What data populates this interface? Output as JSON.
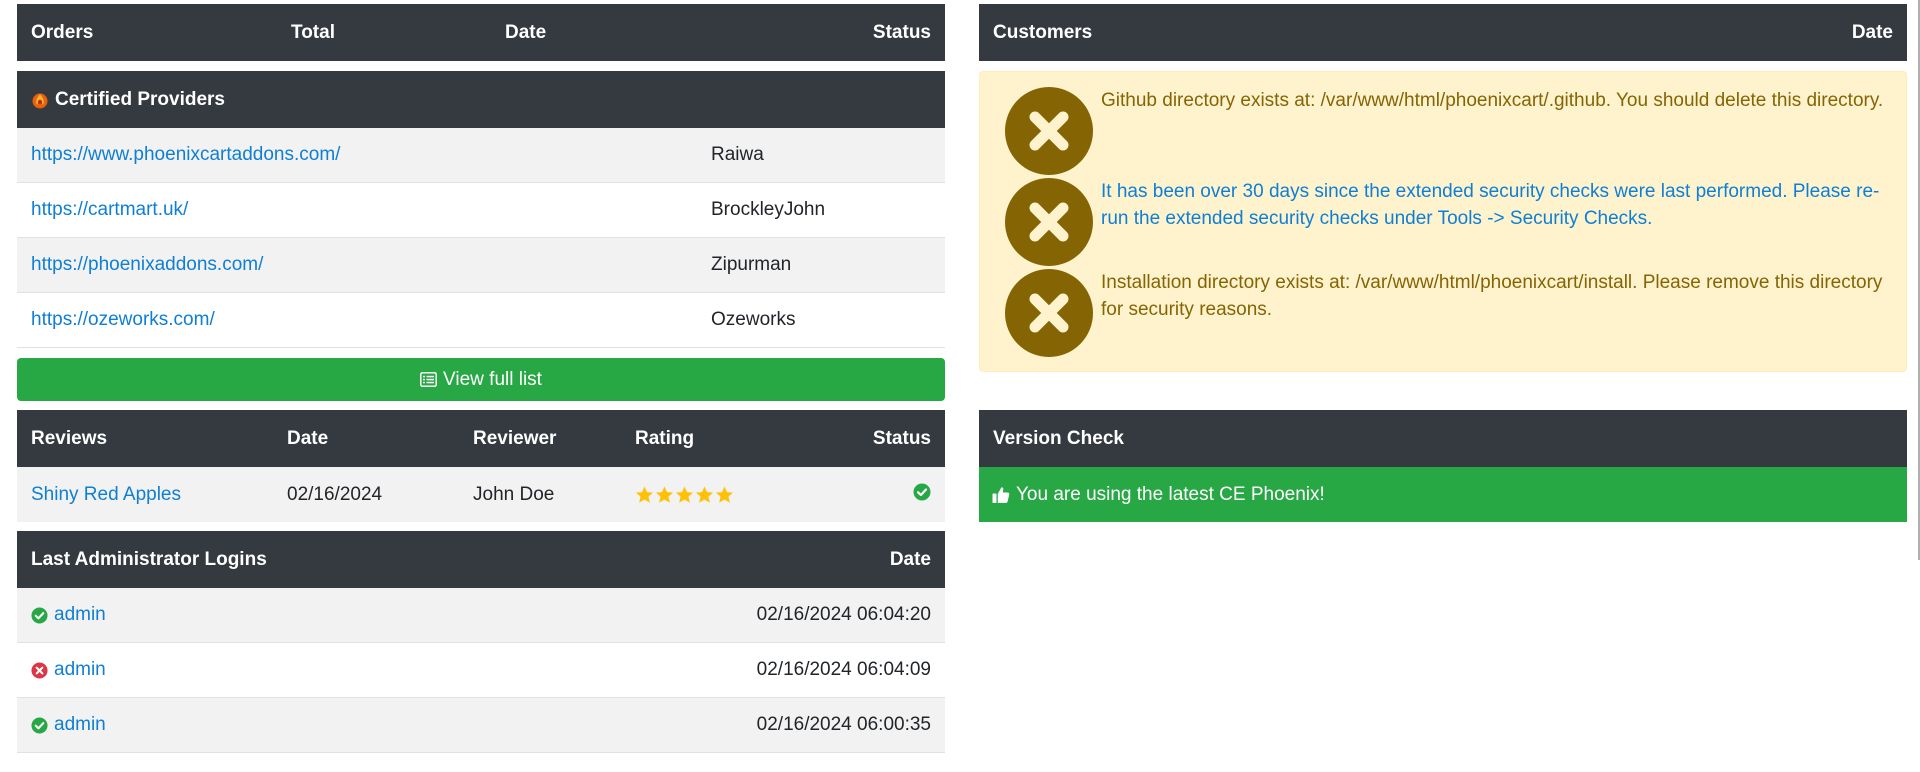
{
  "orders_table": {
    "headers": {
      "orders": "Orders",
      "total": "Total",
      "date": "Date",
      "status": "Status"
    }
  },
  "certified_providers": {
    "title": "Certified Providers",
    "rows": [
      {
        "url": "https://www.phoenixcartaddons.com/",
        "name": "Raiwa"
      },
      {
        "url": "https://cartmart.uk/",
        "name": "BrockleyJohn"
      },
      {
        "url": "https://phoenixaddons.com/",
        "name": "Zipurman"
      },
      {
        "url": "https://ozeworks.com/",
        "name": "Ozeworks"
      }
    ],
    "view_full_list": "View full list"
  },
  "reviews": {
    "headers": {
      "reviews": "Reviews",
      "date": "Date",
      "reviewer": "Reviewer",
      "rating": "Rating",
      "status": "Status"
    },
    "rows": [
      {
        "product": "Shiny Red Apples",
        "date": "02/16/2024",
        "reviewer": "John Doe",
        "rating": 5,
        "status": "approved"
      }
    ]
  },
  "admin_logins": {
    "headers": {
      "title": "Last Administrator Logins",
      "date": "Date"
    },
    "rows": [
      {
        "status": "success",
        "user": "admin",
        "date": "02/16/2024 06:04:20"
      },
      {
        "status": "failed",
        "user": "admin",
        "date": "02/16/2024 06:04:09"
      },
      {
        "status": "success",
        "user": "admin",
        "date": "02/16/2024 06:00:35"
      }
    ]
  },
  "customers": {
    "headers": {
      "customers": "Customers",
      "date": "Date"
    }
  },
  "security_alerts": [
    {
      "text": "Github directory exists at: /var/www/html/phoenixcart/.github. You should delete this directory.",
      "style": "plain"
    },
    {
      "text": "It has been over 30 days since the extended security checks were last performed. Please re-run the extended security checks under Tools -> Security Checks.",
      "style": "link"
    },
    {
      "text": "Installation directory exists at: /var/www/html/phoenixcart/install. Please remove this directory for security reasons.",
      "style": "plain"
    }
  ],
  "version_check": {
    "title": "Version Check",
    "message": "You are using the latest CE Phoenix!"
  },
  "colors": {
    "header_bg": "#343a40",
    "success_green": "#28a745",
    "danger_red": "#dc3545",
    "link_blue": "#0d7fd6",
    "warning_bg": "#fff3cd",
    "warning_text": "#856404",
    "star_yellow": "#ffc107"
  },
  "icons": {
    "providers": "phoenix-logo-icon",
    "list": "list-icon",
    "thumbs_up": "thumbs-up-icon",
    "alert": "x-circle-icon"
  }
}
